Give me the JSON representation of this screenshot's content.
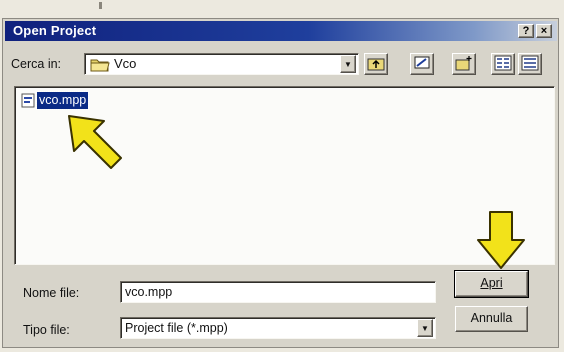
{
  "window": {
    "title": "Open Project"
  },
  "title_buttons": {
    "help": "?",
    "close": "×"
  },
  "toolbar": {
    "look_in_label": "Cerca in:",
    "look_in_value": "Vco",
    "icons": [
      "up-folder-icon",
      "desktop-icon",
      "new-folder-icon",
      "list-view-icon",
      "details-view-icon"
    ]
  },
  "files": [
    {
      "name": "vco.mpp",
      "selected": true
    }
  ],
  "filename": {
    "label": "Nome file:",
    "value": "vco.mpp"
  },
  "filetype": {
    "label": "Tipo file:",
    "value": "Project file (*.mpp)"
  },
  "buttons": {
    "open": "Apri",
    "cancel": "Annulla"
  },
  "colors": {
    "title_start": "#10217d",
    "selection": "#0a2a86",
    "arrow_yellow": "#f2e21a"
  }
}
